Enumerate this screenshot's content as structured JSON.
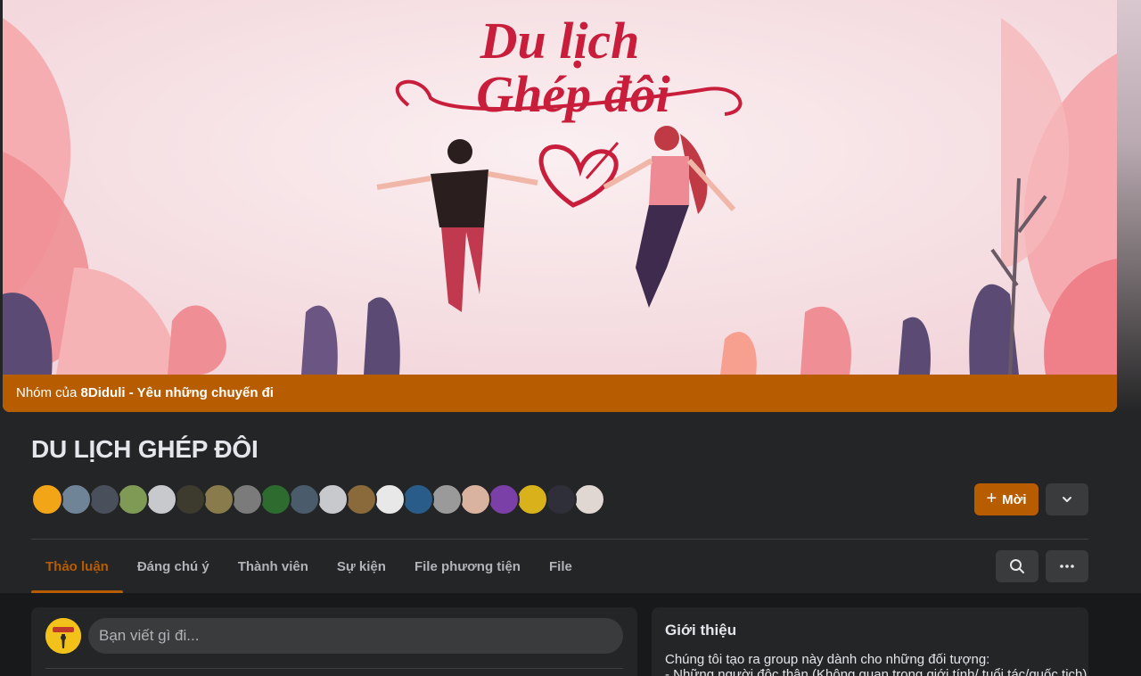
{
  "cover": {
    "artwork_text_line1": "Du lịch",
    "artwork_text_line2": "Ghép đôi",
    "owner_prefix": "Nhóm của ",
    "owner_name": "8Diduli - Yêu những chuyến đi"
  },
  "group": {
    "title": "DU LỊCH GHÉP ĐÔI"
  },
  "member_avatars": [
    {
      "color": "#f2a516"
    },
    {
      "color": "#6f8597"
    },
    {
      "color": "#4a4f5c"
    },
    {
      "color": "#7f9a55"
    },
    {
      "color": "#c7c9cc"
    },
    {
      "color": "#3d3a2e"
    },
    {
      "color": "#8a7b4c"
    },
    {
      "color": "#7b7b7b"
    },
    {
      "color": "#2d6b2f"
    },
    {
      "color": "#4a5b6b"
    },
    {
      "color": "#c7c9cc"
    },
    {
      "color": "#8a6a3a"
    },
    {
      "color": "#e8e8e8"
    },
    {
      "color": "#2a5c8a"
    },
    {
      "color": "#9a9a9a"
    },
    {
      "color": "#d9b3a0"
    },
    {
      "color": "#7b3fa8"
    },
    {
      "color": "#d9b21b"
    },
    {
      "color": "#2f2f3a"
    },
    {
      "color": "#e0d6d2"
    }
  ],
  "actions": {
    "invite_label": "Mời"
  },
  "tabs": [
    {
      "label": "Thảo luận",
      "active": true
    },
    {
      "label": "Đáng chú ý"
    },
    {
      "label": "Thành viên"
    },
    {
      "label": "Sự kiện"
    },
    {
      "label": "File phương tiện"
    },
    {
      "label": "File"
    }
  ],
  "composer": {
    "placeholder": "Bạn viết gì đi..."
  },
  "intro": {
    "title": "Giới thiệu",
    "line1": "Chúng tôi tạo ra group này dành cho những đối tượng:",
    "line2": "- Những người độc thân (Không quan trọng giới tính/ tuổi tác/quốc tịch)"
  },
  "colors": {
    "accent": "#b85c00",
    "background": "#18191a",
    "surface": "#242526",
    "button_secondary": "#3a3b3c"
  },
  "icons": {
    "invite": "plus-icon",
    "expand": "chevron-down-icon",
    "search": "search-icon",
    "more": "more-horizontal-icon"
  }
}
